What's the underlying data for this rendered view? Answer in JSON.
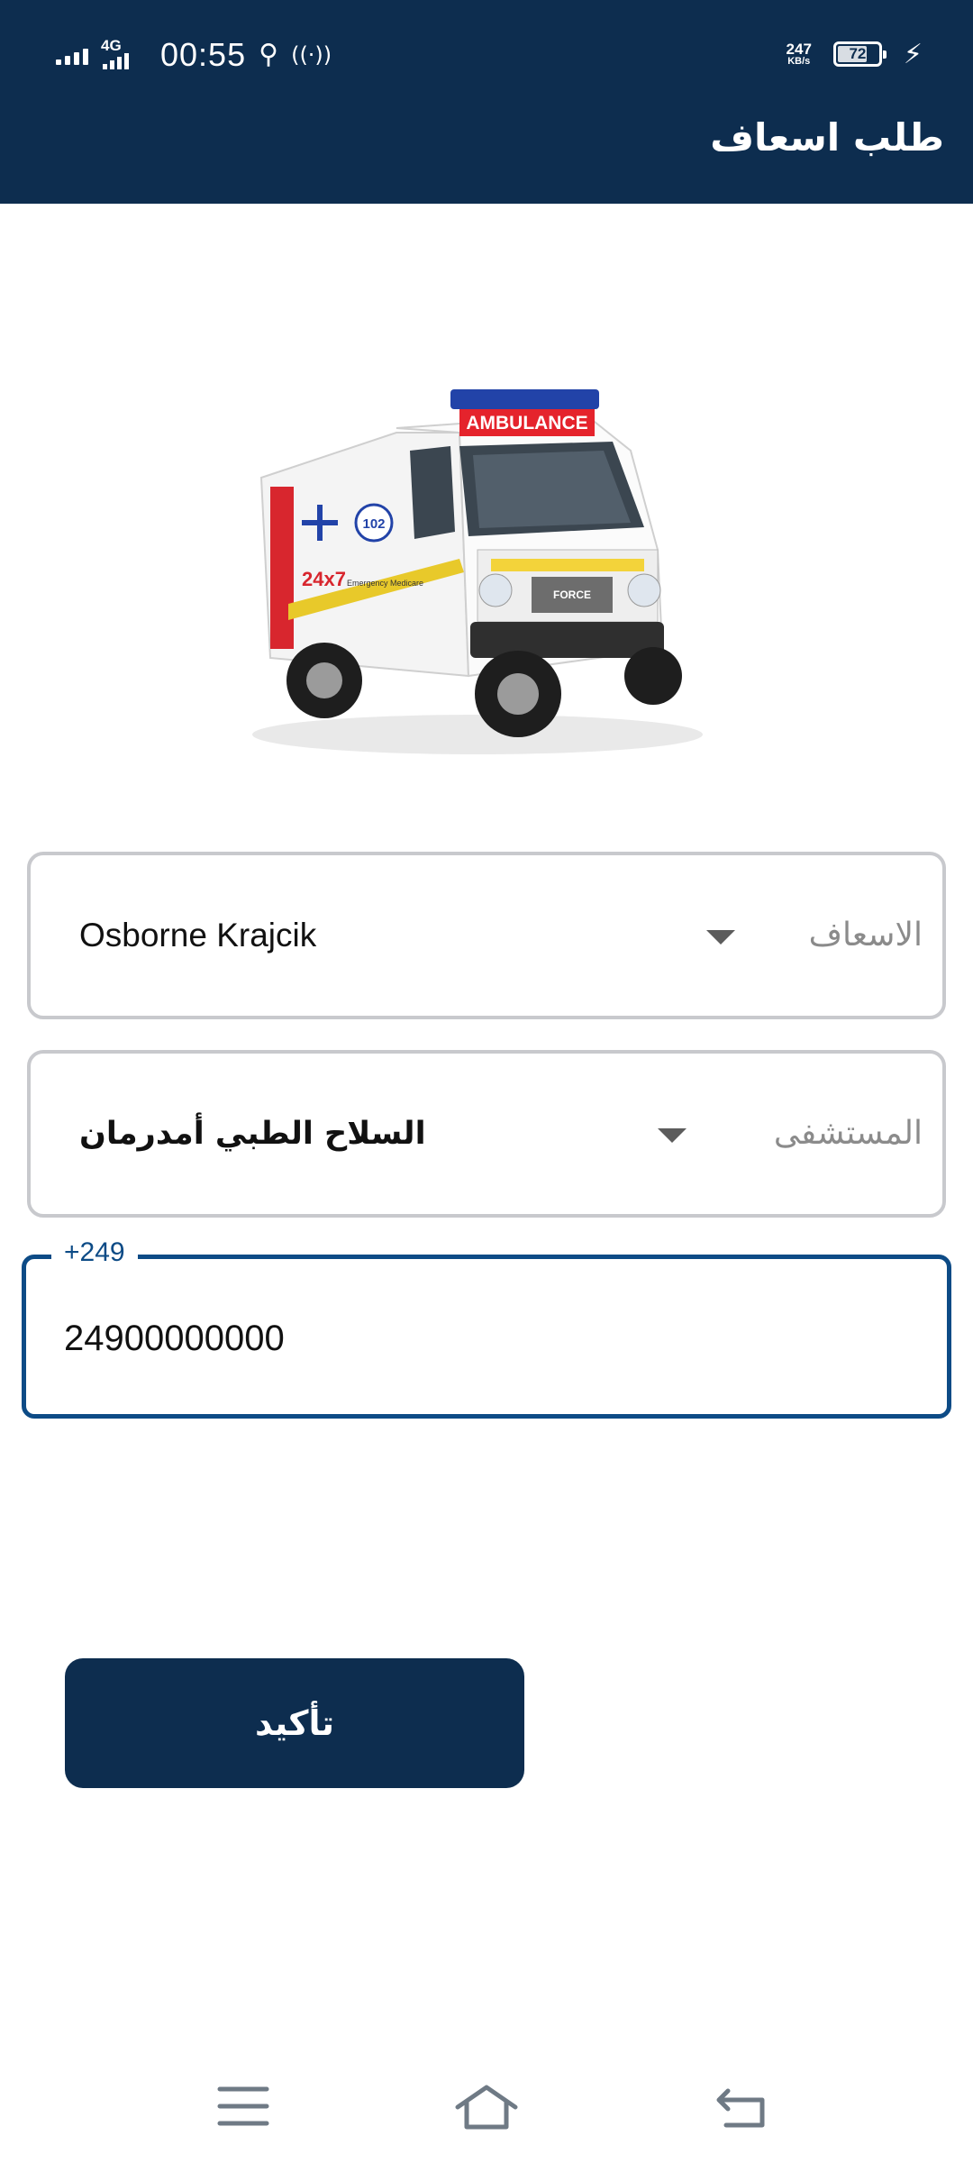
{
  "status_bar": {
    "network": "4G",
    "time": "00:55",
    "speed_value": "247",
    "speed_unit": "KB/s",
    "battery_level": "72",
    "battery_fraction": 0.72
  },
  "header": {
    "title": "طلب اسعاف"
  },
  "form": {
    "ambulance": {
      "label": "الاسعاف",
      "value": "Osborne Krajcik"
    },
    "hospital": {
      "label": "المستشفى",
      "value": "السلاح الطبي أمدرمان"
    },
    "phone": {
      "prefix": "+249",
      "value": "24900000000"
    },
    "confirm_label": "تأكيد"
  },
  "hero_image": {
    "banner_text": "AMBULANCE",
    "side_text": "24x7",
    "side_subtext": "Emergency Medicare",
    "badge": "102",
    "grille_text": "FORCE"
  },
  "icons": {
    "usb": "usb-icon",
    "hotspot": "hotspot-icon",
    "bolt": "charging-icon",
    "menu": "menu-icon",
    "home": "home-icon",
    "back": "back-icon"
  },
  "colors": {
    "primary": "#0d2d4f",
    "focus": "#0d4b86",
    "field_border": "#c8c9cd",
    "label_gray": "#8b8b8b"
  }
}
